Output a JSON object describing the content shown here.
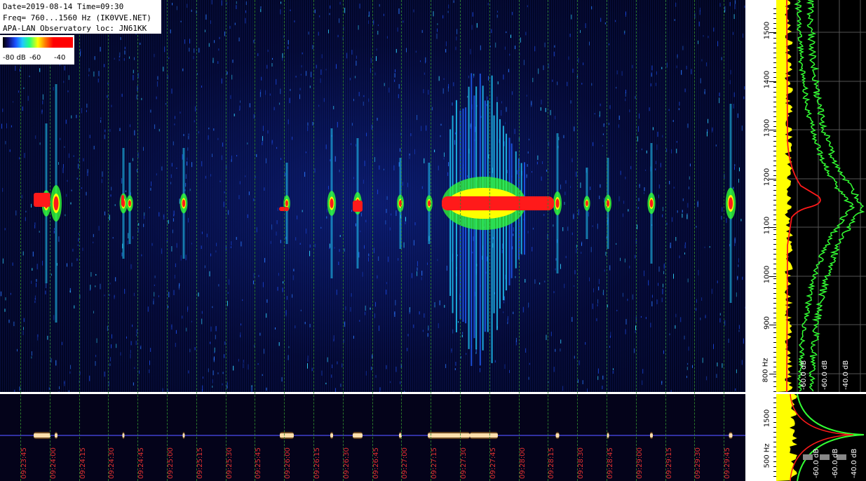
{
  "info": {
    "line1": "Date=2019-08-14 Time=09:30",
    "line2": "Freq= 760...1560 Hz (IK0VVE.NET)",
    "line3": "APA-LAN Observatory loc: JN61KK"
  },
  "colorbar": {
    "label_a": "-80 dB",
    "label_b": "-60",
    "label_c": "-40"
  },
  "freq_axis": {
    "ticks": [
      "1500",
      "1400",
      "1300",
      "1200",
      "1100",
      "1000",
      "900",
      "800 Hz"
    ],
    "lower_ticks": [
      "1500",
      "500 Hz"
    ]
  },
  "spectrum_panel": {
    "db_labels": [
      "-60.0 dB",
      "-60.0 dB",
      "-40.0 dB"
    ],
    "lower_db_labels": [
      "-60.0 dB",
      "-60.0 dB",
      "-40.0 dB"
    ]
  },
  "time_axis": {
    "labels": [
      "09:23:45",
      "09:24:00",
      "09:24:15",
      "09:24:30",
      "09:24:45",
      "09:25:00",
      "09:25:15",
      "09:25:30",
      "09:25:45",
      "09:26:00",
      "09:26:15",
      "09:26:30",
      "09:26:45",
      "09:27:00",
      "09:27:15",
      "09:27:30",
      "09:27:45",
      "09:28:00",
      "09:28:15",
      "09:28:30",
      "09:28:45",
      "09:29:00",
      "09:29:15",
      "09:29:30",
      "09:29:45"
    ]
  },
  "colors": {
    "signal_red": "#ff1a1a",
    "signal_yellow": "#ffff00",
    "signal_green": "#33ff33",
    "signal_cyan": "#20d0ff",
    "grid_green": "#2f8a2f",
    "time_label_red": "#e03030"
  }
}
